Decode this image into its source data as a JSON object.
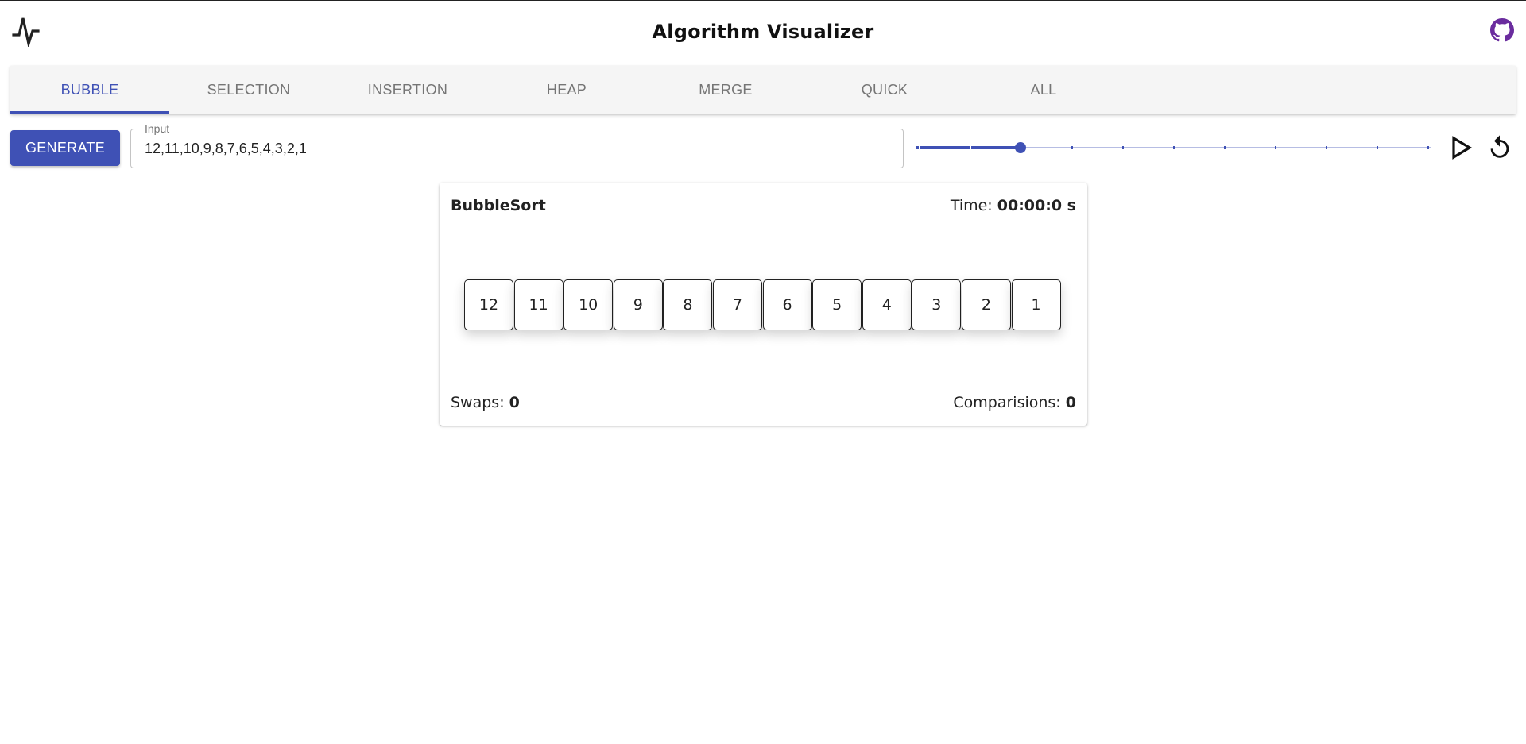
{
  "header": {
    "title": "Algorithm Visualizer",
    "logo_icon": "activity-pulse-icon",
    "github_icon": "github-icon",
    "github_color": "#6a2c9e"
  },
  "tabs": [
    {
      "label": "BUBBLE",
      "active": true
    },
    {
      "label": "SELECTION",
      "active": false
    },
    {
      "label": "INSERTION",
      "active": false
    },
    {
      "label": "HEAP",
      "active": false
    },
    {
      "label": "MERGE",
      "active": false
    },
    {
      "label": "QUICK",
      "active": false
    },
    {
      "label": "ALL",
      "active": false
    }
  ],
  "controls": {
    "generate_label": "GENERATE",
    "input_label": "Input",
    "input_value": "12,11,10,9,8,7,6,5,4,3,2,1",
    "speed_slider": {
      "value": 2,
      "min": 0,
      "max": 10,
      "step": 1
    },
    "play_icon": "play-icon",
    "reset_icon": "replay-icon"
  },
  "card": {
    "title": "BubbleSort",
    "time_label": "Time:",
    "time_value": "00:00:0 s",
    "array": [
      "12",
      "11",
      "10",
      "9",
      "8",
      "7",
      "6",
      "5",
      "4",
      "3",
      "2",
      "1"
    ],
    "swaps_label": "Swaps:",
    "swaps_value": "0",
    "comparisons_label": "Comparisions:",
    "comparisons_value": "0"
  },
  "colors": {
    "primary": "#3f51b5",
    "tab_inactive": "#757575",
    "tabbar_bg": "#f5f5f5"
  }
}
